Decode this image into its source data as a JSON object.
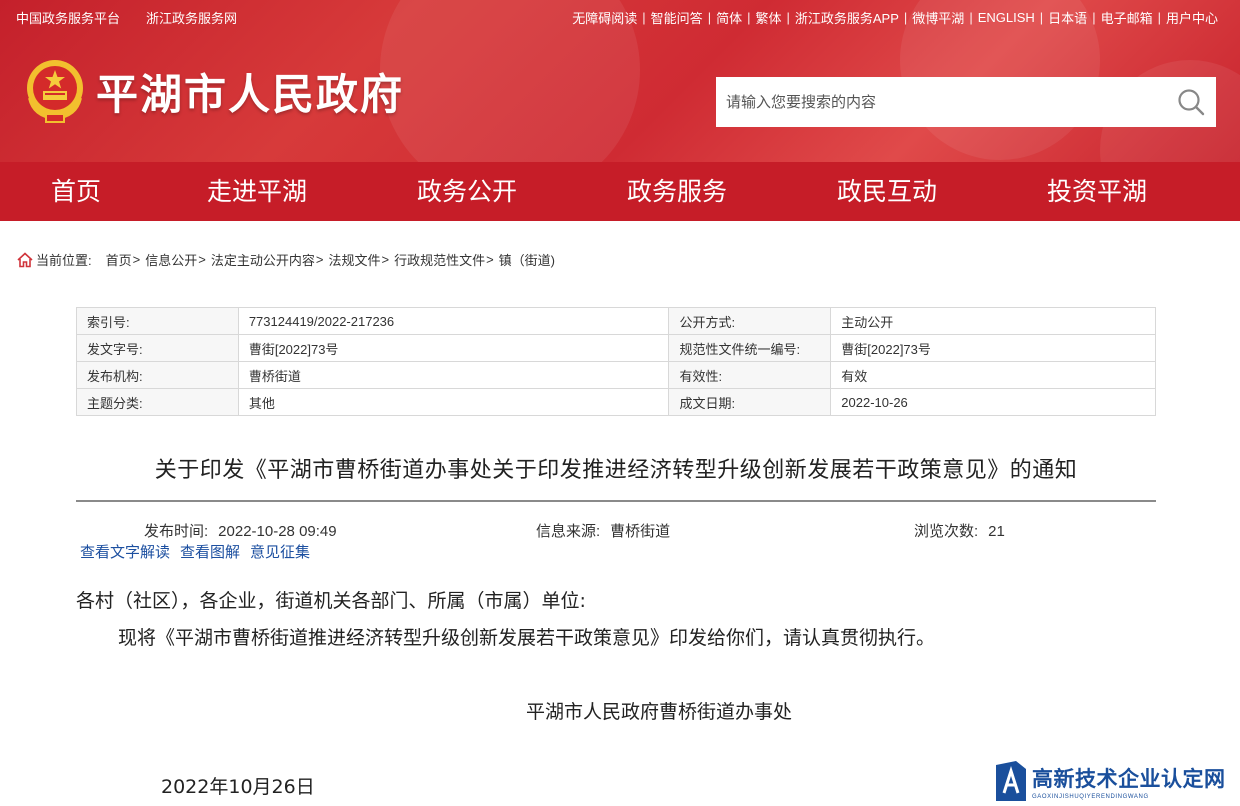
{
  "topbar": {
    "left": [
      "中国政务服务平台",
      "浙江政务服务网"
    ],
    "right": [
      "无障碍阅读",
      "智能问答",
      "简体",
      "繁体",
      "浙江政务服务APP",
      "微博平湖",
      "ENGLISH",
      "日本语",
      "电子邮箱",
      "用户中心"
    ]
  },
  "site_title": "平湖市人民政府",
  "search": {
    "placeholder": "请输入您要搜索的内容"
  },
  "nav": [
    "首页",
    "走进平湖",
    "政务公开",
    "政务服务",
    "政民互动",
    "投资平湖"
  ],
  "breadcrumb": {
    "label": "当前位置:",
    "items": [
      "首页",
      "信息公开",
      "法定主动公开内容",
      "法规文件",
      "行政规范性文件",
      "镇（街道)"
    ]
  },
  "info_table": [
    {
      "k1": "索引号:",
      "v1": "773124419/2022-217236",
      "k2": "公开方式:",
      "v2": "主动公开"
    },
    {
      "k1": "发文字号:",
      "v1": "曹街[2022]73号",
      "k2": "规范性文件统一编号:",
      "v2": "曹街[2022]73号"
    },
    {
      "k1": "发布机构:",
      "v1": "曹桥街道",
      "k2": "有效性:",
      "v2": "有效"
    },
    {
      "k1": "主题分类:",
      "v1": "其他",
      "k2": "成文日期:",
      "v2": "2022-10-26"
    }
  ],
  "article": {
    "title": "关于印发《平湖市曹桥街道办事处关于印发推进经济转型升级创新发展若干政策意见》的通知",
    "publish_label": "发布时间:",
    "publish_time": "2022-10-28 09:49",
    "source_label": "信息来源:",
    "source": "曹桥街道",
    "views_label": "浏览次数:",
    "views": "21",
    "links": [
      "查看文字解读",
      "查看图解",
      "意见征集"
    ],
    "salutation": "各村（社区），各企业，街道机关各部门、所属（市属）单位:",
    "paragraph": "现将《平湖市曹桥街道推进经济转型升级创新发展若干政策意见》印发给你们，请认真贯彻执行。",
    "signature": "平湖市人民政府曹桥街道办事处",
    "date": "2022年10月26日"
  },
  "watermark": {
    "main": "高新技术企业认定网",
    "sub": "GAOXINJISHUQIYERENDINGWANG"
  },
  "colors": {
    "brand_red": "#c61d28",
    "link_blue": "#1c4fa0"
  }
}
